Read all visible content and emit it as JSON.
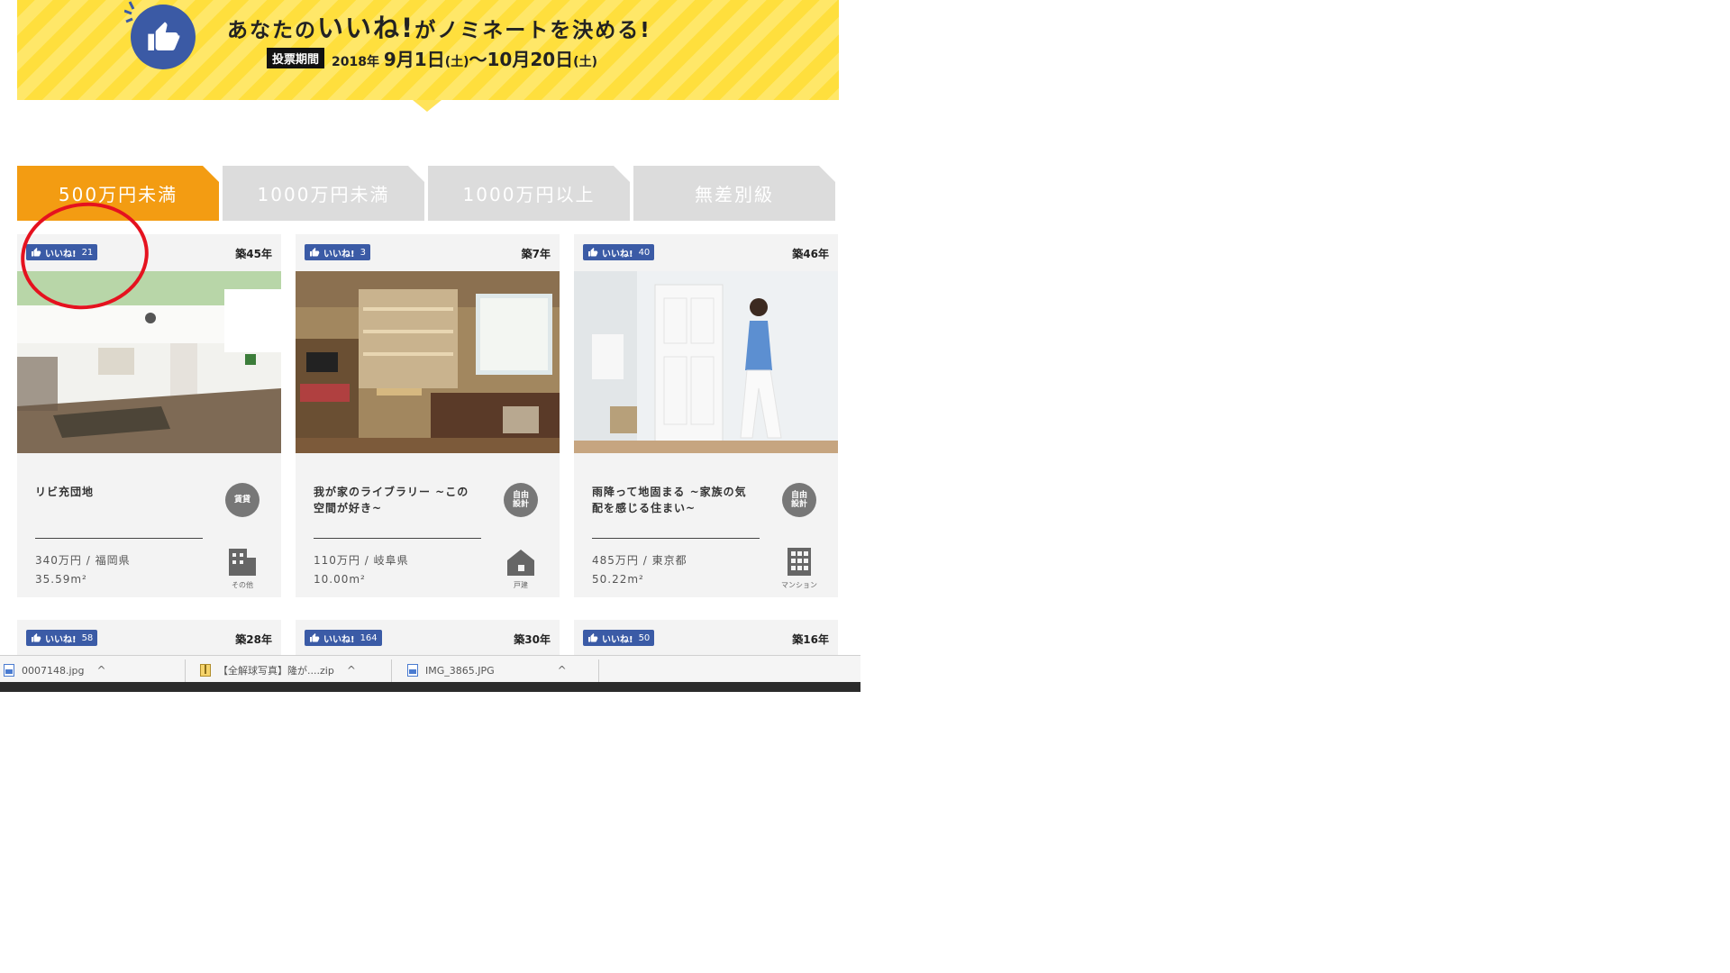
{
  "banner": {
    "title_pre": "あなたの",
    "title_big": "いいね!",
    "title_post": "がノミネートを決める!",
    "period_label": "投票期間",
    "period_year": "2018年",
    "period_start": "9月1日",
    "period_start_day": "(土)",
    "period_sep": "〜",
    "period_end": "10月20日",
    "period_end_day": "(土)"
  },
  "tabs": [
    {
      "label": "500万円未満",
      "active": true
    },
    {
      "label": "1000万円未満",
      "active": false
    },
    {
      "label": "1000万円以上",
      "active": false
    },
    {
      "label": "無差別級",
      "active": false
    }
  ],
  "cards": [
    {
      "like_label": "いいね!",
      "likes": "21",
      "age": "築45年",
      "title": "リビ充団地",
      "category": "賃貸",
      "price_location": "340万円 / 福岡県",
      "area": "35.59m²",
      "type": "その他",
      "type_icon": "building-icon"
    },
    {
      "like_label": "いいね!",
      "likes": "3",
      "age": "築7年",
      "title": "我が家のライブラリー ~この空間が好き~",
      "category": "自由\n設計",
      "price_location": "110万円 / 岐阜県",
      "area": "10.00m²",
      "type": "戸建",
      "type_icon": "house-icon"
    },
    {
      "like_label": "いいね!",
      "likes": "40",
      "age": "築46年",
      "title": "雨降って地固まる ~家族の気配を感じる住まい~",
      "category": "自由\n設計",
      "price_location": "485万円 / 東京都",
      "area": "50.22m²",
      "type": "マンション",
      "type_icon": "apartment-icon"
    }
  ],
  "cards_row2": [
    {
      "like_label": "いいね!",
      "likes": "58",
      "age": "築28年"
    },
    {
      "like_label": "いいね!",
      "likes": "164",
      "age": "築30年"
    },
    {
      "like_label": "いいね!",
      "likes": "50",
      "age": "築16年"
    }
  ],
  "downloads": [
    {
      "name": "0007148.jpg"
    },
    {
      "name": "【全解球写真】隆が....zip"
    },
    {
      "name": "IMG_3865.JPG"
    }
  ],
  "colors": {
    "accent": "#f39c12",
    "like_blue": "#3b5ba6",
    "banner_yellow": "#ffdf3d",
    "annotation_red": "#e5121f"
  }
}
